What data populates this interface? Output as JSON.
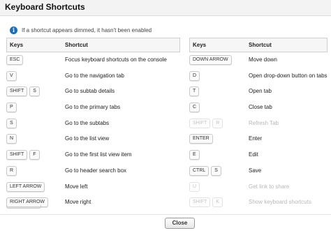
{
  "dialog": {
    "title": "Keyboard Shortcuts",
    "info_text": "If a shortcut appears dimmed, it hasn't been enabled",
    "close_label": "Close"
  },
  "table_headers": {
    "keys": "Keys",
    "shortcut": "Shortcut"
  },
  "left_rows": [
    {
      "keys": [
        "ESC"
      ],
      "description": "Focus keyboard shortcuts on the console",
      "dimmed": false
    },
    {
      "keys": [
        "V"
      ],
      "description": "Go to the navigation tab",
      "dimmed": false
    },
    {
      "keys": [
        "SHIFT",
        "S"
      ],
      "description": "Go to subtab details",
      "dimmed": false
    },
    {
      "keys": [
        "P"
      ],
      "description": "Go to the primary tabs",
      "dimmed": false
    },
    {
      "keys": [
        "S"
      ],
      "description": "Go to the subtabs",
      "dimmed": false
    },
    {
      "keys": [
        "N"
      ],
      "description": "Go to the list view",
      "dimmed": false
    },
    {
      "keys": [
        "SHIFT",
        "F"
      ],
      "description": "Go to the first list view item",
      "dimmed": false
    },
    {
      "keys": [
        "R"
      ],
      "description": "Go to header search box",
      "dimmed": false
    },
    {
      "keys": [
        "LEFT ARROW"
      ],
      "description": "Move left",
      "dimmed": false
    },
    {
      "keys": [
        "RIGHT ARROW"
      ],
      "description": "Move right",
      "dimmed": false
    }
  ],
  "right_rows": [
    {
      "keys": [
        "DOWN ARROW"
      ],
      "description": "Move down",
      "dimmed": false
    },
    {
      "keys": [
        "D"
      ],
      "description": "Open drop-down button on tabs",
      "dimmed": false
    },
    {
      "keys": [
        "T"
      ],
      "description": "Open tab",
      "dimmed": false
    },
    {
      "keys": [
        "C"
      ],
      "description": "Close tab",
      "dimmed": false
    },
    {
      "keys": [
        "SHIFT",
        "R"
      ],
      "description": "Refresh Tab",
      "dimmed": true
    },
    {
      "keys": [
        "ENTER"
      ],
      "description": "Enter",
      "dimmed": false
    },
    {
      "keys": [
        "E"
      ],
      "description": "Edit",
      "dimmed": false
    },
    {
      "keys": [
        "CTRL",
        "S"
      ],
      "description": "Save",
      "dimmed": false
    },
    {
      "keys": [
        "U"
      ],
      "description": "Get link to share",
      "dimmed": true
    },
    {
      "keys": [
        "SHIFT",
        "K"
      ],
      "description": "Show keyboard shortcuts",
      "dimmed": true
    }
  ],
  "colors": {
    "info_icon": "#1b6fb8",
    "dimmed_text": "#b8b8b8",
    "header_bg": "#f6f6f6"
  },
  "icons": {
    "info": "info-icon"
  }
}
